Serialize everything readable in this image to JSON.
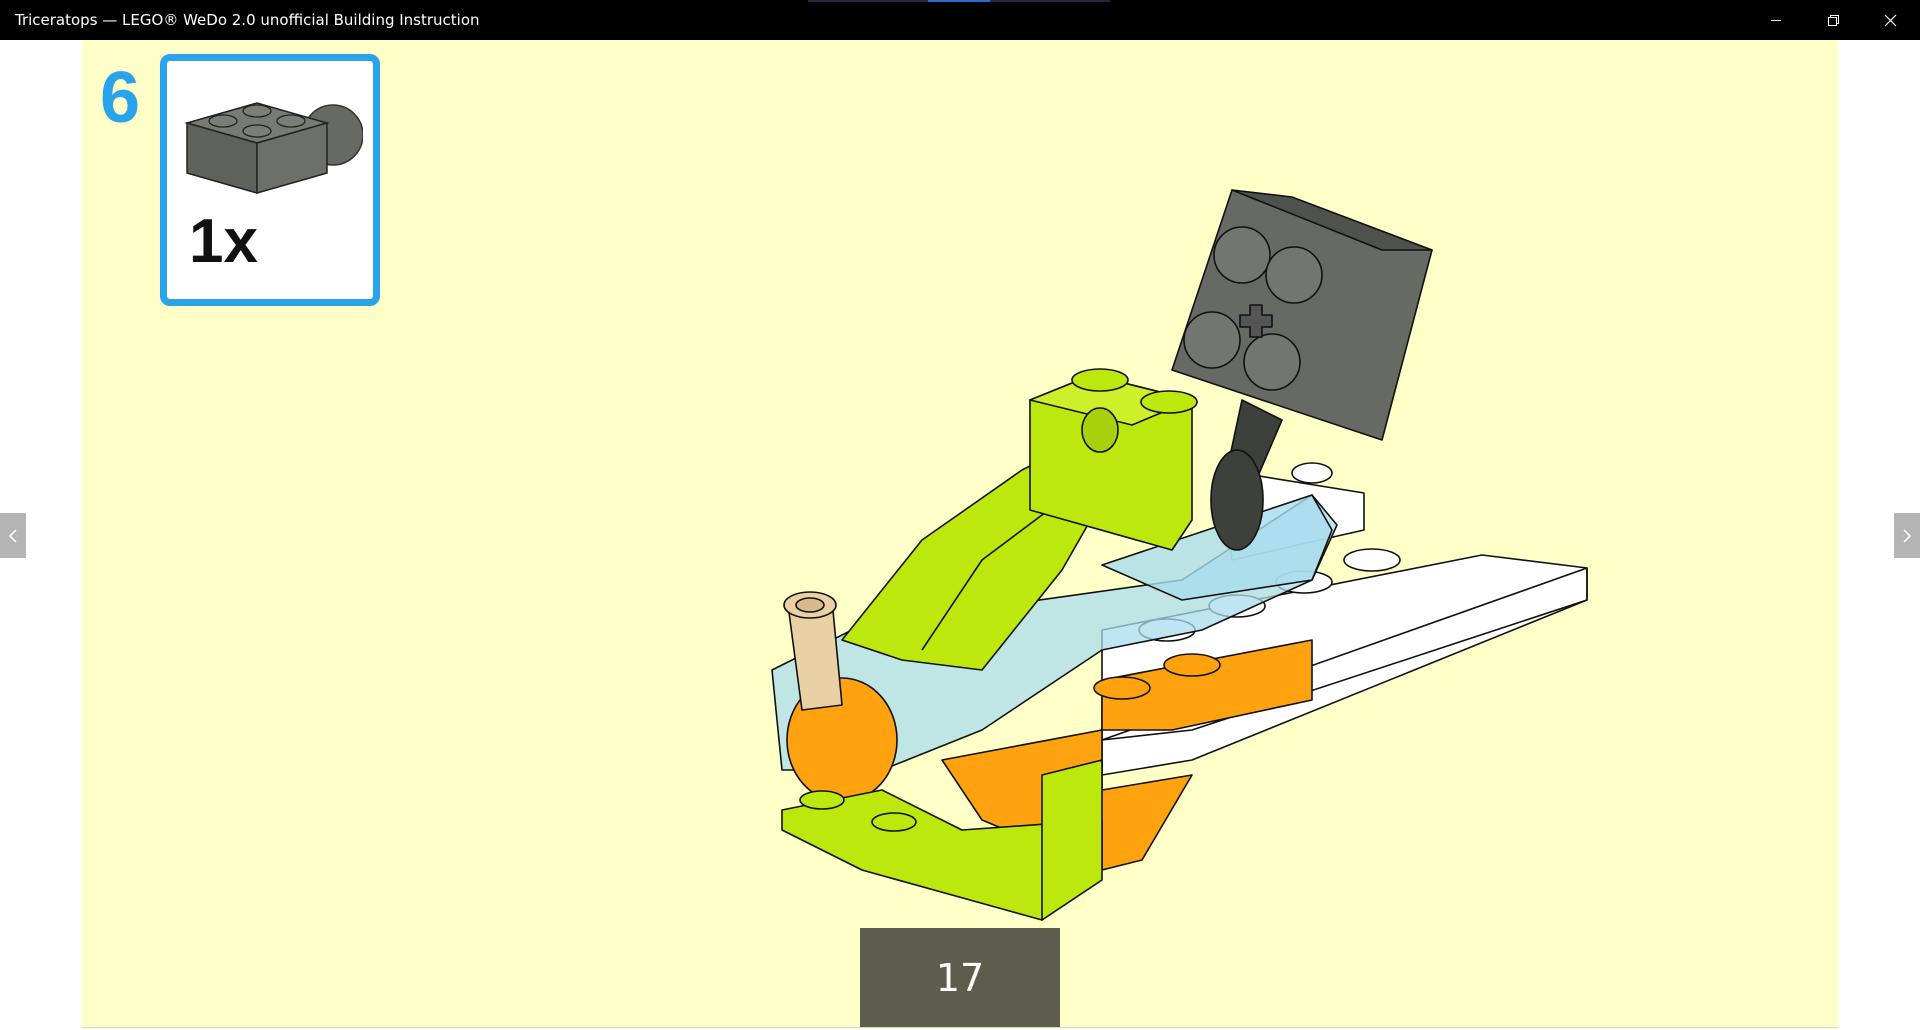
{
  "window": {
    "title": "Triceratops — LEGO® WeDo 2.0 unofficial Building Instruction",
    "controls": [
      "minimize-icon",
      "restore-icon",
      "close-icon"
    ]
  },
  "instruction": {
    "step_number": "6",
    "parts": [
      {
        "part": "dark-gray-2x2-brick-icon",
        "color": "#666a63",
        "quantity": "1x"
      }
    ],
    "page_number": "17"
  },
  "navigation": {
    "previous": "chevron-left-icon",
    "next": "chevron-right-icon"
  },
  "colors": {
    "page_background": "#ffffc8",
    "step_accent": "#29a3ea",
    "lime": "#bde80e",
    "orange": "#ffa20f",
    "dark_gray": "#666a63",
    "trans_light_blue": "#a9dced",
    "tan": "#ead0a5",
    "page_number_bg": "#5d5d4e"
  }
}
